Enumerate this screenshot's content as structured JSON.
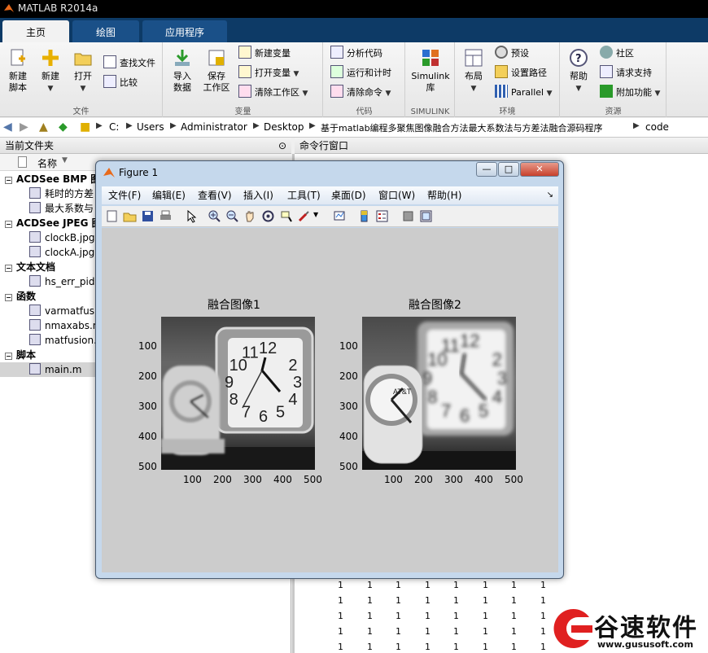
{
  "app": {
    "title": "MATLAB R2014a"
  },
  "tabs": [
    "主页",
    "绘图",
    "应用程序"
  ],
  "ribbon": {
    "file": {
      "new_script": [
        "新建",
        "脚本"
      ],
      "new": "新建",
      "open": "打开",
      "find_files": "查找文件",
      "compare": "比较",
      "label": "文件"
    },
    "variable": {
      "import_data": [
        "导入",
        "数据"
      ],
      "save_workspace": [
        "保存",
        "工作区"
      ],
      "new_variable": "新建变量",
      "open_variable": "打开变量",
      "clear_workspace": "清除工作区",
      "label": "变量"
    },
    "code": {
      "analyze_code": "分析代码",
      "run_and_time": "运行和计时",
      "clear_commands": "清除命令",
      "label": "代码"
    },
    "simulink": {
      "button": [
        "Simulink",
        "库"
      ],
      "label": "SIMULINK"
    },
    "environment": {
      "layout": "布局",
      "preferences": "预设",
      "set_path": "设置路径",
      "parallel": "Parallel",
      "label": "环境"
    },
    "resources": {
      "help": "帮助",
      "community": "社区",
      "request_support": "请求支持",
      "add_ons": "附加功能",
      "label": "资源"
    }
  },
  "address": {
    "crumbs": [
      "C:",
      "Users",
      "Administrator",
      "Desktop",
      "基于matlab编程多聚焦图像融合方法最大系数法与方差法融合源码程序",
      "code"
    ]
  },
  "left_panel": {
    "title": "当前文件夹",
    "column_header": "名称",
    "groups": [
      {
        "label": "ACDSee BMP 图",
        "items": [
          "耗时的方差",
          "最大系数与"
        ]
      },
      {
        "label": "ACDSee JPEG 图",
        "items": [
          "clockB.jpg",
          "clockA.jpg"
        ]
      },
      {
        "label": "文本文档",
        "items": [
          "hs_err_pid"
        ]
      },
      {
        "label": "函数",
        "items": [
          "varmatfusi",
          "nmaxabs.m",
          "matfusion."
        ]
      },
      {
        "label": "脚本",
        "items": [
          "main.m"
        ]
      }
    ]
  },
  "command_window": {
    "title": "命令行窗口",
    "value": "1"
  },
  "figure": {
    "title": "Figure 1",
    "menus": [
      "文件(F)",
      "编辑(E)",
      "查看(V)",
      "插入(I)",
      "工具(T)",
      "桌面(D)",
      "窗口(W)",
      "帮助(H)"
    ],
    "axes": [
      {
        "title": "融合图像1",
        "yticks": [
          "100",
          "200",
          "300",
          "400",
          "500"
        ],
        "xticks": [
          "100",
          "200",
          "300",
          "400",
          "500"
        ]
      },
      {
        "title": "融合图像2",
        "yticks": [
          "100",
          "200",
          "300",
          "400",
          "500"
        ],
        "xticks": [
          "100",
          "200",
          "300",
          "400",
          "500"
        ]
      }
    ],
    "clock_numbers": [
      "12",
      "2",
      "3",
      "4",
      "5",
      "6",
      "7",
      "8",
      "9",
      "10",
      "11"
    ]
  },
  "watermark": {
    "brand": "谷速软件",
    "url": "www.gususoft.com"
  },
  "colors": {
    "tab_strip": "#0d3a66",
    "figure_frame": "#c5d8ec",
    "figure_canvas": "#cccccc"
  }
}
